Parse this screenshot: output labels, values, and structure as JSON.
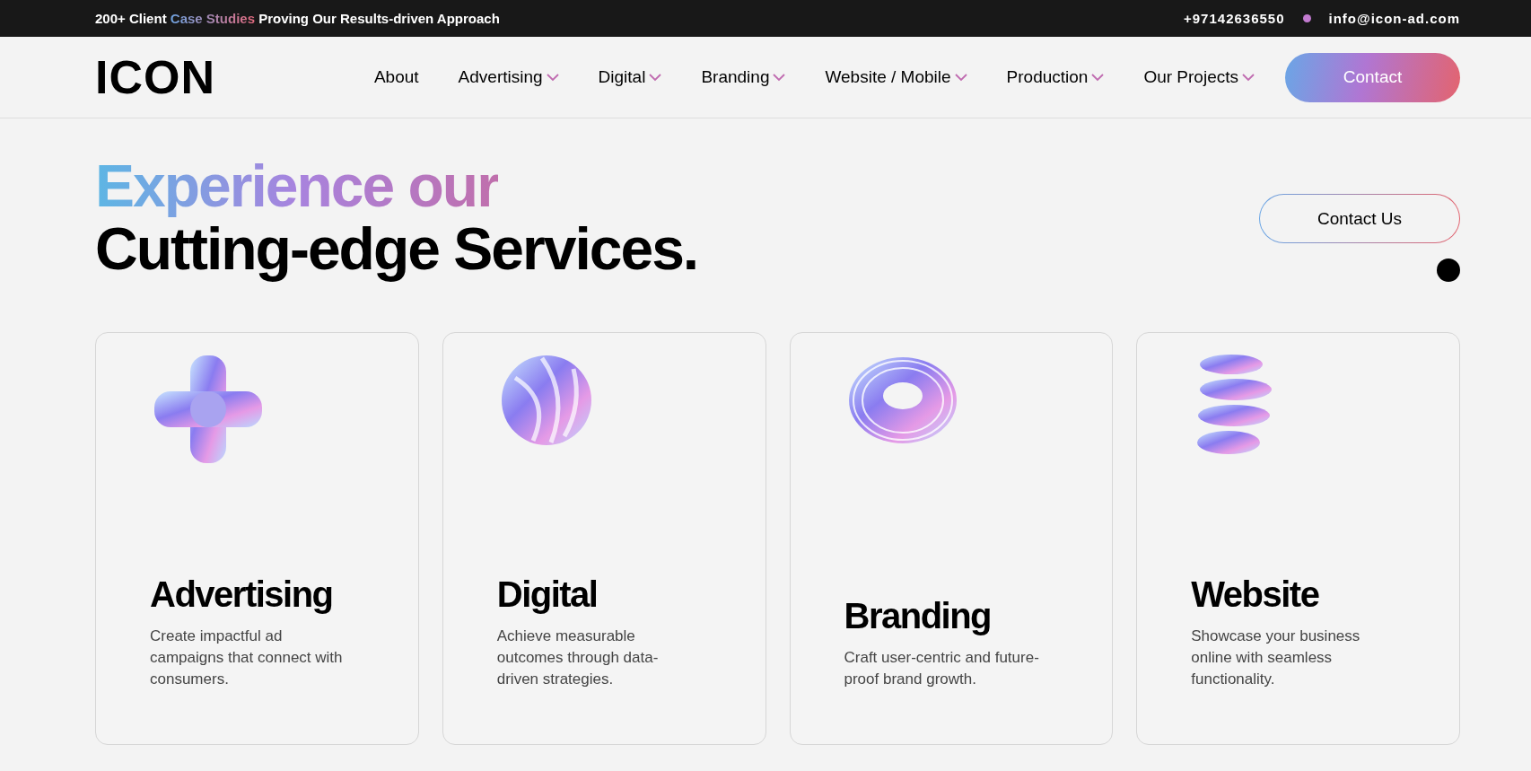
{
  "top_bar": {
    "promo": {
      "before": "200+ Client",
      "highlight": "Case Studies",
      "after": "Proving Our Results-driven Approach"
    },
    "phone": "+97142636550",
    "email": "info@icon-ad.com"
  },
  "header": {
    "logo": "ICON",
    "nav": [
      {
        "label": "About",
        "dropdown": false
      },
      {
        "label": "Advertising",
        "dropdown": true
      },
      {
        "label": "Digital",
        "dropdown": true
      },
      {
        "label": "Branding",
        "dropdown": true
      },
      {
        "label": "Website / Mobile",
        "dropdown": true
      },
      {
        "label": "Production",
        "dropdown": true
      },
      {
        "label": "Our Projects",
        "dropdown": true
      }
    ],
    "cta": "Contact"
  },
  "hero": {
    "title_line_1": "Experience our",
    "title_line_2": "Cutting-edge Services.",
    "button": "Contact Us"
  },
  "services": [
    {
      "kind": "cross",
      "title": "Advertising",
      "description": "Create impactful ad campaigns that connect with consumers."
    },
    {
      "kind": "sphere",
      "title": "Digital",
      "description": "Achieve measurable outcomes through data-driven strategies."
    },
    {
      "kind": "torus",
      "title": "Branding",
      "description": "Craft user-centric and future-proof brand growth."
    },
    {
      "kind": "spiral",
      "title": "Website",
      "description": "Showcase your business online with seamless functionality."
    }
  ]
}
